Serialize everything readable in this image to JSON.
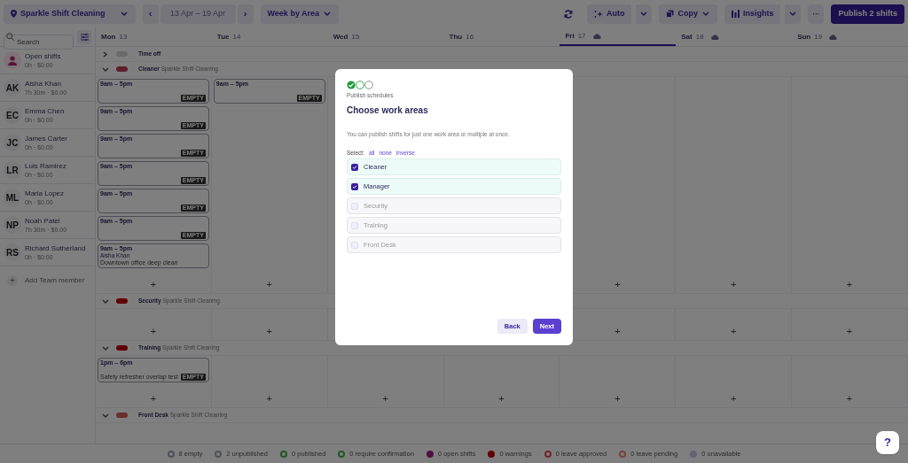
{
  "toolbar": {
    "location": "Sparkle Shift Cleaning",
    "prev": "‹",
    "range": "13 Apr – 19 Apr",
    "next": "›",
    "view": "Week by Area",
    "auto": "Auto",
    "copy": "Copy",
    "insights": "Insights",
    "more": "···",
    "publish": "Publish 2 shifts"
  },
  "search": {
    "placeholder": "Search"
  },
  "days": [
    {
      "name": "Mon",
      "date": "13",
      "selected": false,
      "weather": false
    },
    {
      "name": "Tue",
      "date": "14",
      "selected": false,
      "weather": false
    },
    {
      "name": "Wed",
      "date": "15",
      "selected": false,
      "weather": false
    },
    {
      "name": "Thu",
      "date": "16",
      "selected": false,
      "weather": false
    },
    {
      "name": "Fri",
      "date": "17",
      "selected": true,
      "weather": true
    },
    {
      "name": "Sat",
      "date": "18",
      "selected": false,
      "weather": true
    },
    {
      "name": "Sun",
      "date": "19",
      "selected": false,
      "weather": true
    }
  ],
  "people": [
    {
      "kind": "open",
      "name": "Open shifts",
      "hours": "0h · $0.00"
    },
    {
      "kind": "member",
      "initials": "AK",
      "name": "Aisha Khan",
      "hours": "7h 30m · $0.00"
    },
    {
      "kind": "member",
      "initials": "EC",
      "name": "Emma Chen",
      "hours": "0h · $0.00"
    },
    {
      "kind": "member",
      "initials": "JC",
      "name": "James Carter",
      "hours": "0h · $0.00"
    },
    {
      "kind": "member",
      "initials": "LR",
      "name": "Luis Ramirez",
      "hours": "0h · $0.00"
    },
    {
      "kind": "member",
      "initials": "ML",
      "name": "Maria Lopez",
      "hours": "0h · $0.00"
    },
    {
      "kind": "member",
      "initials": "NP",
      "name": "Noah Patel",
      "hours": "7h 30m · $0.00"
    },
    {
      "kind": "member",
      "initials": "RS",
      "name": "Richard Sutherland",
      "hours": "0h · $0.00"
    }
  ],
  "add_member": {
    "icon": "+",
    "label": "Add Team member"
  },
  "time_off": {
    "label": "Time off",
    "expanded": false
  },
  "areas": [
    {
      "name": "Cleaner",
      "org": "Sparkle Shift Cleaning",
      "color": "#611d2d",
      "expanded": true,
      "columns": [
        {
          "add": "+",
          "shifts": [
            {
              "time": "9am – 5pm",
              "badge": "EMPTY"
            },
            {
              "time": "9am – 5pm",
              "badge": "EMPTY"
            },
            {
              "time": "9am – 5pm",
              "badge": "EMPTY"
            },
            {
              "time": "9am – 5pm",
              "badge": "EMPTY"
            },
            {
              "time": "9am – 5pm",
              "badge": "EMPTY"
            },
            {
              "time": "9am – 5pm",
              "badge": "EMPTY"
            },
            {
              "time": "9am – 5pm",
              "assignee": "Aisha Khan",
              "note": "Downtown office deep clean"
            }
          ]
        },
        {
          "add": "+",
          "shifts": [
            {
              "time": "9am – 5pm",
              "badge": "EMPTY"
            }
          ]
        },
        {},
        {},
        {
          "add": "+"
        },
        {
          "add": "+"
        },
        {
          "add": "+"
        }
      ]
    },
    {
      "name": "Security",
      "org": "Sparkle Shift Cleaning",
      "color": "#600000",
      "expanded": true,
      "columns": [
        {
          "add": "+"
        },
        {
          "add": "+"
        },
        {},
        {},
        {
          "add": "+"
        },
        {
          "add": "+"
        },
        {
          "add": "+"
        }
      ]
    },
    {
      "name": "Training",
      "org": "Sparkle Shift Cleaning",
      "color": "#600000",
      "expanded": true,
      "columns": [
        {
          "add": "+",
          "shifts": [
            {
              "time": "1pm – 6pm",
              "note": "Safety refresher overlap test",
              "badge": "EMPTY"
            }
          ]
        },
        {
          "add": "+"
        },
        {
          "add": "+"
        },
        {
          "add": "+"
        },
        {
          "add": "+"
        },
        {
          "add": "+"
        },
        {
          "add": "+"
        }
      ]
    },
    {
      "name": "Front Desk",
      "org": "Sparkle Shift Cleaning",
      "color": "#6b2d2d",
      "expanded": true
    }
  ],
  "legend": [
    {
      "label": "8 empty",
      "color": "#4e5157",
      "kind": "outline"
    },
    {
      "label": "2 unpublished",
      "color": "#4e5157",
      "kind": "outline"
    },
    {
      "label": "0 published",
      "color": "#1f5725",
      "kind": "outline"
    },
    {
      "label": "0 require confirmation",
      "color": "#1f5725",
      "kind": "outline"
    },
    {
      "label": "0 open shifts",
      "color": "#50113f",
      "kind": "filled"
    },
    {
      "label": "0 warnings",
      "color": "#600000",
      "kind": "filled"
    },
    {
      "label": "0 leave approved",
      "color": "#702828",
      "kind": "outline"
    },
    {
      "label": "0 leave pending",
      "color": "#784040",
      "kind": "outline"
    },
    {
      "label": "0 unavailable",
      "color": "#646277",
      "kind": "filled"
    }
  ],
  "help": {
    "label": "?"
  },
  "dialog": {
    "steps": [
      {
        "completed": true,
        "selected": false
      },
      {
        "completed": false,
        "selected": true
      },
      {
        "completed": false,
        "selected": false
      }
    ],
    "subtitle": "Publish schedules",
    "title": "Choose work areas",
    "description": "You can publish shifts for just one work area or multiple at once.",
    "select_label": "Select:",
    "select_links": [
      "all",
      "none",
      "inverse"
    ],
    "areas": [
      {
        "label": "Cleaner",
        "checked": true
      },
      {
        "label": "Manager",
        "checked": true
      },
      {
        "label": "Security",
        "checked": false
      },
      {
        "label": "Training",
        "checked": false
      },
      {
        "label": "Front Desk",
        "checked": false
      }
    ],
    "buttons": [
      {
        "label": "Back",
        "kind": "secondary"
      },
      {
        "label": "Next",
        "kind": "primary"
      }
    ]
  }
}
